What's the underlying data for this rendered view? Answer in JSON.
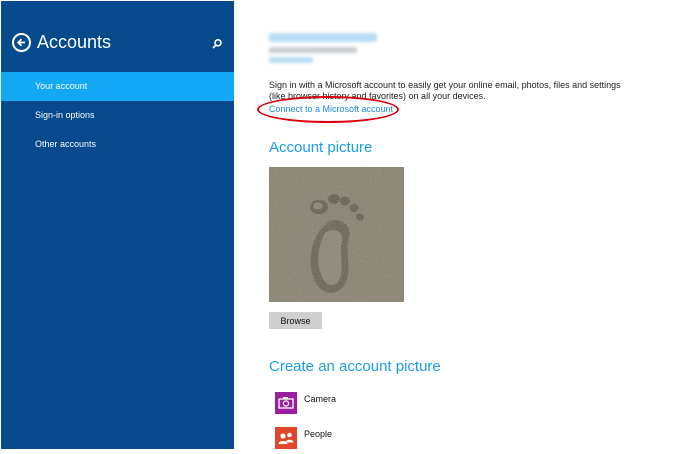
{
  "sidebar": {
    "title": "Accounts",
    "accent_color": "#054a8d",
    "selected_color": "#12a8f4",
    "items": [
      {
        "label": "Your account",
        "selected": true
      },
      {
        "label": "Sign-in options",
        "selected": false
      },
      {
        "label": "Other accounts",
        "selected": false
      }
    ]
  },
  "account": {
    "description": "Sign in with a Microsoft account to easily get your online email, photos, files and settings (like browser history and favorites) on all your devices.",
    "connect_link": "Connect to a Microsoft account"
  },
  "picture_section": {
    "title": "Account picture",
    "browse_label": "Browse"
  },
  "create_section": {
    "title": "Create an account picture",
    "apps": [
      {
        "label": "Camera",
        "icon": "camera-icon",
        "color": "#9c1ea0"
      },
      {
        "label": "People",
        "icon": "people-icon",
        "color": "#e0462a"
      }
    ]
  }
}
